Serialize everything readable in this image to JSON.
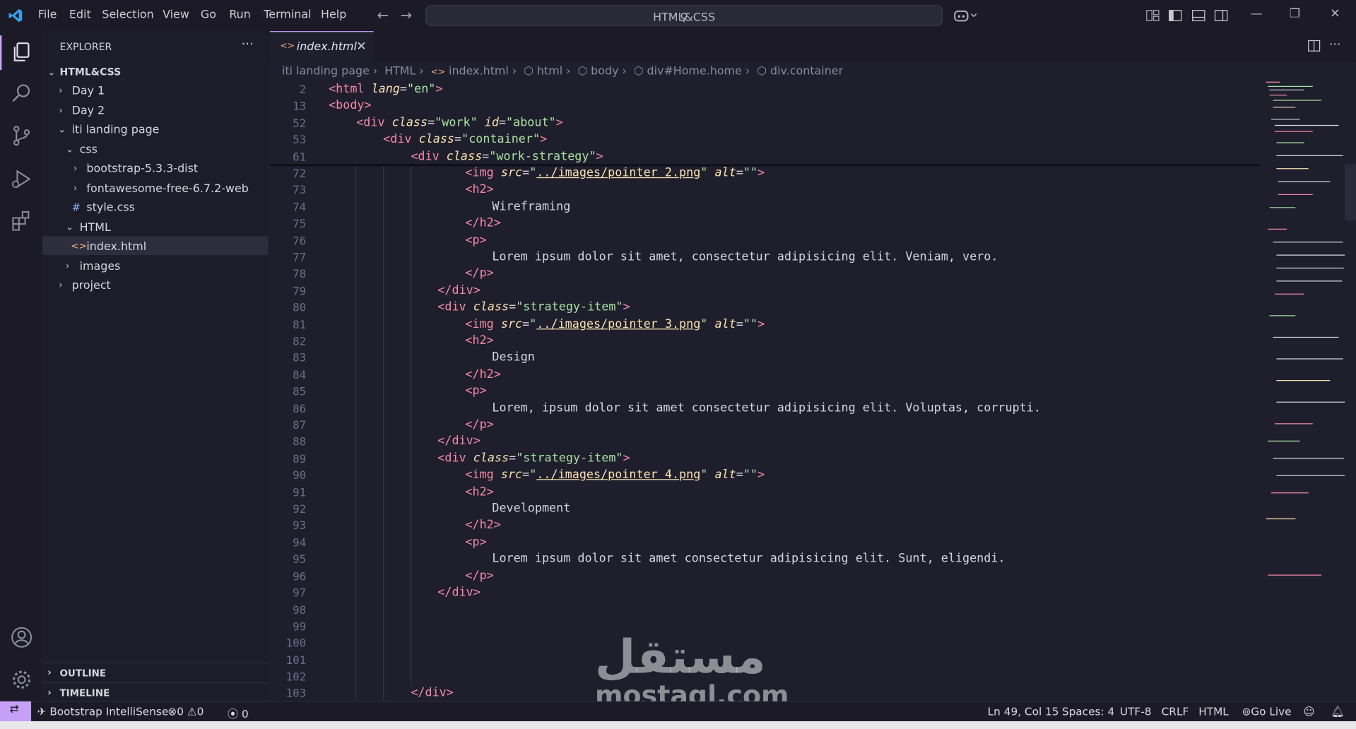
{
  "menu": [
    "File",
    "Edit",
    "Selection",
    "View",
    "Go",
    "Run",
    "Terminal",
    "Help"
  ],
  "search": {
    "text": "HTML&CSS"
  },
  "sidebar": {
    "title": "EXPLORER",
    "root": "HTML&CSS",
    "items": [
      {
        "label": "Day 1"
      },
      {
        "label": "Day 2"
      },
      {
        "label": "iti landing page"
      },
      {
        "label": "css"
      },
      {
        "label": "bootstrap-5.3.3-dist"
      },
      {
        "label": "fontawesome-free-6.7.2-web"
      },
      {
        "label": "style.css"
      },
      {
        "label": "HTML"
      },
      {
        "label": "index.html"
      },
      {
        "label": "images"
      },
      {
        "label": "project"
      }
    ],
    "panels": [
      "OUTLINE",
      "TIMELINE"
    ]
  },
  "tab": {
    "label": "index.html"
  },
  "breadcrumbs": [
    "iti landing page",
    "HTML",
    "index.html",
    "html",
    "body",
    "div#Home.home",
    "div.container"
  ],
  "code_lines": [
    {
      "n": "2",
      "parts": [
        [
          "tag",
          "<html "
        ],
        [
          "attr",
          "lang"
        ],
        [
          "txt",
          "="
        ],
        [
          "str",
          "\"en\""
        ],
        [
          "tag",
          ">"
        ]
      ]
    },
    {
      "n": "13",
      "parts": [
        [
          "tag",
          "<body>"
        ]
      ]
    },
    {
      "n": "52",
      "parts": [
        [
          "tag",
          "<div "
        ],
        [
          "attr",
          "class"
        ],
        [
          "txt",
          "="
        ],
        [
          "str",
          "\"work\" "
        ],
        [
          "attr",
          "id"
        ],
        [
          "txt",
          "="
        ],
        [
          "str",
          "\"about\""
        ],
        [
          "tag",
          ">"
        ]
      ]
    },
    {
      "n": "53",
      "parts": [
        [
          "tag",
          "<div "
        ],
        [
          "attr",
          "class"
        ],
        [
          "txt",
          "="
        ],
        [
          "str",
          "\"container\""
        ],
        [
          "tag",
          ">"
        ]
      ]
    },
    {
      "n": "61",
      "parts": [
        [
          "tag",
          "<div "
        ],
        [
          "attr",
          "class"
        ],
        [
          "txt",
          "="
        ],
        [
          "str",
          "\"work-strategy\""
        ],
        [
          "tag",
          ">"
        ]
      ]
    },
    {
      "n": "72",
      "parts": [
        [
          "tag",
          "<img "
        ],
        [
          "attr",
          "src"
        ],
        [
          "txt",
          "="
        ],
        [
          "str",
          "\""
        ],
        [
          "link",
          "../images/pointer 2.png"
        ],
        [
          "str",
          "\" "
        ],
        [
          "attr",
          "alt"
        ],
        [
          "txt",
          "="
        ],
        [
          "str",
          "\"\""
        ],
        [
          "tag",
          ">"
        ]
      ]
    },
    {
      "n": "73",
      "parts": [
        [
          "tag",
          "<h2>"
        ]
      ]
    },
    {
      "n": "74",
      "parts": [
        [
          "txt",
          "Wireframing"
        ]
      ]
    },
    {
      "n": "75",
      "parts": [
        [
          "tag",
          "</h2>"
        ]
      ]
    },
    {
      "n": "76",
      "parts": [
        [
          "tag",
          "<p>"
        ]
      ]
    },
    {
      "n": "77",
      "parts": [
        [
          "txt",
          "Lorem ipsum dolor sit amet, consectetur adipisicing elit. Veniam, vero."
        ]
      ]
    },
    {
      "n": "78",
      "parts": [
        [
          "tag",
          "</p>"
        ]
      ]
    },
    {
      "n": "79",
      "parts": [
        [
          "tag",
          "</div>"
        ]
      ]
    },
    {
      "n": "80",
      "parts": [
        [
          "tag",
          "<div "
        ],
        [
          "attr",
          "class"
        ],
        [
          "txt",
          "="
        ],
        [
          "str",
          "\"strategy-item\""
        ],
        [
          "tag",
          ">"
        ]
      ]
    },
    {
      "n": "81",
      "parts": [
        [
          "tag",
          "<img "
        ],
        [
          "attr",
          "src"
        ],
        [
          "txt",
          "="
        ],
        [
          "str",
          "\""
        ],
        [
          "link",
          "../images/pointer 3.png"
        ],
        [
          "str",
          "\" "
        ],
        [
          "attr",
          "alt"
        ],
        [
          "txt",
          "="
        ],
        [
          "str",
          "\"\""
        ],
        [
          "tag",
          ">"
        ]
      ]
    },
    {
      "n": "82",
      "parts": [
        [
          "tag",
          "<h2>"
        ]
      ]
    },
    {
      "n": "83",
      "parts": [
        [
          "txt",
          "Design"
        ]
      ]
    },
    {
      "n": "84",
      "parts": [
        [
          "tag",
          "</h2>"
        ]
      ]
    },
    {
      "n": "85",
      "parts": [
        [
          "tag",
          "<p>"
        ]
      ]
    },
    {
      "n": "86",
      "parts": [
        [
          "txt",
          "Lorem, ipsum dolor sit amet consectetur adipisicing elit. Voluptas, corrupti."
        ]
      ]
    },
    {
      "n": "87",
      "parts": [
        [
          "tag",
          "</p>"
        ]
      ]
    },
    {
      "n": "88",
      "parts": [
        [
          "tag",
          "</div>"
        ]
      ]
    },
    {
      "n": "89",
      "parts": [
        [
          "tag",
          "<div "
        ],
        [
          "attr",
          "class"
        ],
        [
          "txt",
          "="
        ],
        [
          "str",
          "\"strategy-item\""
        ],
        [
          "tag",
          ">"
        ]
      ]
    },
    {
      "n": "90",
      "parts": [
        [
          "tag",
          "<img "
        ],
        [
          "attr",
          "src"
        ],
        [
          "txt",
          "="
        ],
        [
          "str",
          "\""
        ],
        [
          "link",
          "../images/pointer 4.png"
        ],
        [
          "str",
          "\" "
        ],
        [
          "attr",
          "alt"
        ],
        [
          "txt",
          "="
        ],
        [
          "str",
          "\"\""
        ],
        [
          "tag",
          ">"
        ]
      ]
    },
    {
      "n": "91",
      "parts": [
        [
          "tag",
          "<h2>"
        ]
      ]
    },
    {
      "n": "92",
      "parts": [
        [
          "txt",
          "Development"
        ]
      ]
    },
    {
      "n": "93",
      "parts": [
        [
          "tag",
          "</h2>"
        ]
      ]
    },
    {
      "n": "94",
      "parts": [
        [
          "tag",
          "<p>"
        ]
      ]
    },
    {
      "n": "95",
      "parts": [
        [
          "txt",
          "Lorem ipsum dolor sit amet consectetur adipisicing elit. Sunt, eligendi."
        ]
      ]
    },
    {
      "n": "96",
      "parts": [
        [
          "tag",
          "</p>"
        ]
      ]
    },
    {
      "n": "97",
      "parts": [
        [
          "tag",
          "</div>"
        ]
      ]
    },
    {
      "n": "98",
      "parts": []
    },
    {
      "n": "99",
      "parts": []
    },
    {
      "n": "100",
      "parts": []
    },
    {
      "n": "101",
      "parts": []
    },
    {
      "n": "102",
      "parts": []
    },
    {
      "n": "103",
      "parts": [
        [
          "tag",
          "</div>"
        ]
      ]
    }
  ],
  "statusbar": {
    "extension": "Bootstrap IntelliSense",
    "errors": "0",
    "warnings": "0",
    "ports": "0",
    "position": "Ln 49, Col 15",
    "spaces": "Spaces: 4",
    "encoding": "UTF-8",
    "eol": "CRLF",
    "language": "HTML",
    "golive": "Go Live"
  },
  "watermark": {
    "arabic": "مستقل",
    "latin": "mostaql.com"
  },
  "colors": {
    "accent": "#c6a0f6",
    "tag": "#f38ba8",
    "attr": "#f9e2af",
    "string": "#a6e3a1",
    "background": "#1f1e2c"
  }
}
